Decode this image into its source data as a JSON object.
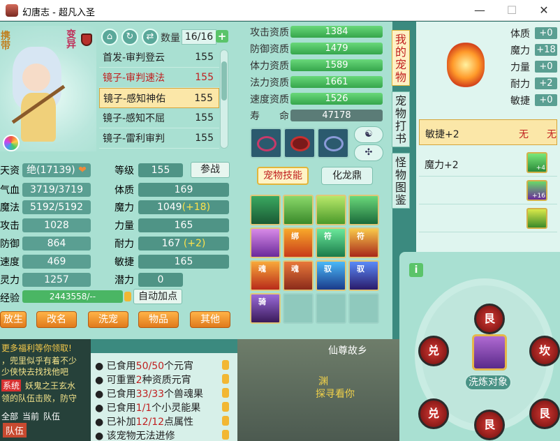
{
  "window": {
    "title": "幻唐志 - 超凡入圣",
    "minimize": "—",
    "maximize": "☐",
    "close": "✕"
  },
  "pet": {
    "tag_left": "携带",
    "tag_bian": "变异",
    "quantity_label": "数量",
    "quantity_value": "16/16",
    "plus_label": "+",
    "list": [
      {
        "name": "首发-审判登云",
        "level": "155",
        "style": "normal"
      },
      {
        "name": "镜子-审判速法",
        "level": "155",
        "style": "red"
      },
      {
        "name": "镜子-感知神佑",
        "level": "155",
        "style": "selected"
      },
      {
        "name": "镜子-感知不屈",
        "level": "155",
        "style": "normal"
      },
      {
        "name": "镜子-雷利审判",
        "level": "155",
        "style": "normal"
      }
    ]
  },
  "stats": {
    "tianzi_label": "天资",
    "tianzi_value": "绝(17139)",
    "qixue_label": "气血",
    "qixue_value": "3719/3719",
    "mofa_label": "魔法",
    "mofa_value": "5192/5192",
    "gongji_label": "攻击",
    "gongji_value": "1028",
    "fangyu_label": "防御",
    "fangyu_value": "864",
    "sudu_label": "速度",
    "sudu_value": "469",
    "lingli_label": "灵力",
    "lingli_value": "1257",
    "jingyan_label": "经验",
    "jingyan_value": "2443558/--",
    "dengji_label": "等级",
    "dengji_value": "155",
    "tizhi_label": "体质",
    "tizhi_value": "169",
    "moli_label": "魔力",
    "moli_value": "1049",
    "moli_plus": "(+18)",
    "liliang_label": "力量",
    "liliang_value": "165",
    "naili_label": "耐力",
    "naili_value": "167",
    "naili_plus": "(+2)",
    "minjie_label": "敏捷",
    "minjie_value": "165",
    "qianli_label": "潜力",
    "qianli_value": "0",
    "canzhan": "参战",
    "auto_add": "自动加点"
  },
  "bottom_buttons": [
    "放生",
    "改名",
    "洗宠",
    "物品",
    "其他"
  ],
  "aptitude": [
    {
      "label": "攻击资质",
      "value": "1384"
    },
    {
      "label": "防御资质",
      "value": "1479"
    },
    {
      "label": "体力资质",
      "value": "1589"
    },
    {
      "label": "法力资质",
      "value": "1661"
    },
    {
      "label": "速度资质",
      "value": "1526"
    },
    {
      "label": "寿　　命",
      "value": "47178"
    }
  ],
  "tabs": {
    "skill": "宠物技能",
    "hualong": "化龙鼎"
  },
  "skills_tags": [
    "",
    "",
    "",
    "",
    "",
    "绑",
    "符",
    "符",
    "魂",
    "魂",
    "驭",
    "驭",
    "骑"
  ],
  "side_tabs": [
    "我的宠物",
    "宠物打书",
    "怪物图鉴"
  ],
  "attributes": [
    {
      "label": "体质",
      "value": "+0"
    },
    {
      "label": "魔力",
      "value": "+18"
    },
    {
      "label": "力量",
      "value": "+0"
    },
    {
      "label": "耐力",
      "value": "+2"
    },
    {
      "label": "敏捷",
      "value": "+0"
    }
  ],
  "effects": [
    {
      "name": "敏捷+2",
      "c1": "无",
      "c2": "无",
      "icon_tag": ""
    },
    {
      "name": "魔力+2",
      "c1": "",
      "c2": "",
      "icon_tag": "+4"
    },
    {
      "name": "",
      "c1": "",
      "c2": "",
      "icon_tag": "+16"
    },
    {
      "name": "",
      "c1": "",
      "c2": "",
      "icon_tag": ""
    }
  ],
  "chat": {
    "lines": [
      "更多福利等你领取!",
      "，兜里似乎有着不少",
      "少侠快去找找他吧",
      "妖鬼之王玄水",
      "领的队伍击败，防守"
    ],
    "system_label": "系统",
    "nav": [
      "全部",
      "当前",
      "队伍",
      "队伍"
    ]
  },
  "info_list": [
    {
      "pre": "已食用",
      "red": "50/50",
      "post": "个元宵"
    },
    {
      "pre": "可重置",
      "red": "2",
      "post": "种资质元宵"
    },
    {
      "pre": "已食用",
      "red": "33/33",
      "post": "个兽魂果"
    },
    {
      "pre": "已食用",
      "red": "1/1",
      "post": "个小灵能果"
    },
    {
      "pre": "已补加",
      "red": "12/12",
      "post": "点属性"
    },
    {
      "pre": "该宠物无法进修",
      "red": "",
      "post": ""
    }
  ],
  "wheel": {
    "trigrams": [
      "艮",
      "兑",
      "坎",
      "兑",
      "艮",
      "艮"
    ],
    "refine_btn": "洗炼对象",
    "info": "i"
  },
  "scene": {
    "text1": "仙尊故乡",
    "text2": "渊",
    "text3": "探寻看你"
  },
  "colors": {
    "accent_red": "#c02020",
    "gold_border": "#d4a43a",
    "panel": "#a9e0d2",
    "green_bar": "#4ab664"
  }
}
